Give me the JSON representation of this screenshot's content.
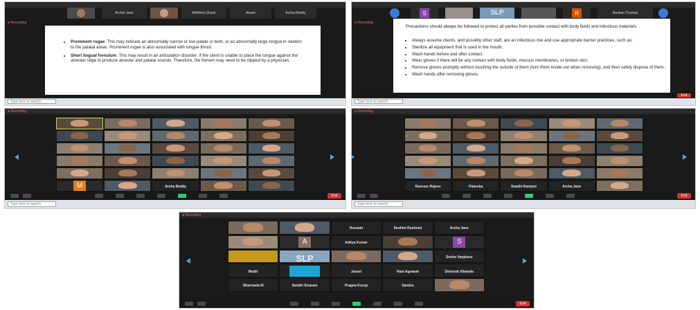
{
  "common": {
    "search_placeholder": "Type here to search",
    "end_label": "End",
    "rec_label": "● Recording"
  },
  "shot1": {
    "strip_names": [
      "Archie Jane",
      "Abhibha Ghosh",
      "Akash",
      "Archa Reddy"
    ],
    "bullets": [
      {
        "head": "Prominent rugae",
        "text": ": This may indicate an abnormally narrow or low palate or both, or an abnormally large tongue in relation to the palatal areas. Prominent rugae is also associated with tongue thrust."
      },
      {
        "head": "Short lingual frenulum",
        "text": ": This may result in an articulation disorder: if the client is unable to place the tongue against the alveolar ridge to produce alveolar and palatal sounds. Therefore, the frenum may need to be clipped by a physician."
      }
    ]
  },
  "shot2": {
    "strip": [
      {
        "kind": "letter",
        "letter": "S",
        "color": "#8e44ad"
      },
      {
        "kind": "slp",
        "text": "SLP"
      },
      {
        "kind": "letter",
        "letter": "R",
        "color": "#d35400"
      }
    ],
    "strip_name": "Roshan Thomas",
    "intro": "Precautions should always be followed to protect all parties from possible contact with body fluids and infectious materials.",
    "bullets": [
      "Always assume clients, and possibly other staff, are an infectious risk and use appropriate barrier practices, such as:",
      "Sterilize all equipment that is used in the mouth.",
      "Wash hands before and after contact.",
      "Wear gloves if there will be any contact with body fluids, mucous membranes, or broken skin.",
      "Remove gloves promptly without touching the outside of them (turn them inside out when removing), and then safely dispose of them.",
      "Wash hands after removing gloves."
    ]
  },
  "shot3": {
    "avatar_letter": "M",
    "avatar_color": "#e67e22",
    "named_tile": "Archa Reddy"
  },
  "shot4": {
    "names": [
      "Ranveer Rajeev",
      "Pakeeba",
      "Swathi Ramjeet",
      "Archa Jane"
    ]
  },
  "shot5": {
    "black_tiles": [
      "Hussain",
      "Ibrahim Rasheed",
      "Archa Jane",
      "Aditya Kumar",
      "Sneha Varghese",
      "Mudit",
      "Jaseel",
      "Ram Agrawal",
      "Deborah Albanda",
      "Sharmada M",
      "Swathi Sivaram",
      "Pragna Kurup",
      "Sandra"
    ],
    "letter_a": "A",
    "letter_a_color": "#8d6e63",
    "letter_s": "S",
    "letter_s_color": "#8e44ad",
    "slp_text": "SLP"
  }
}
